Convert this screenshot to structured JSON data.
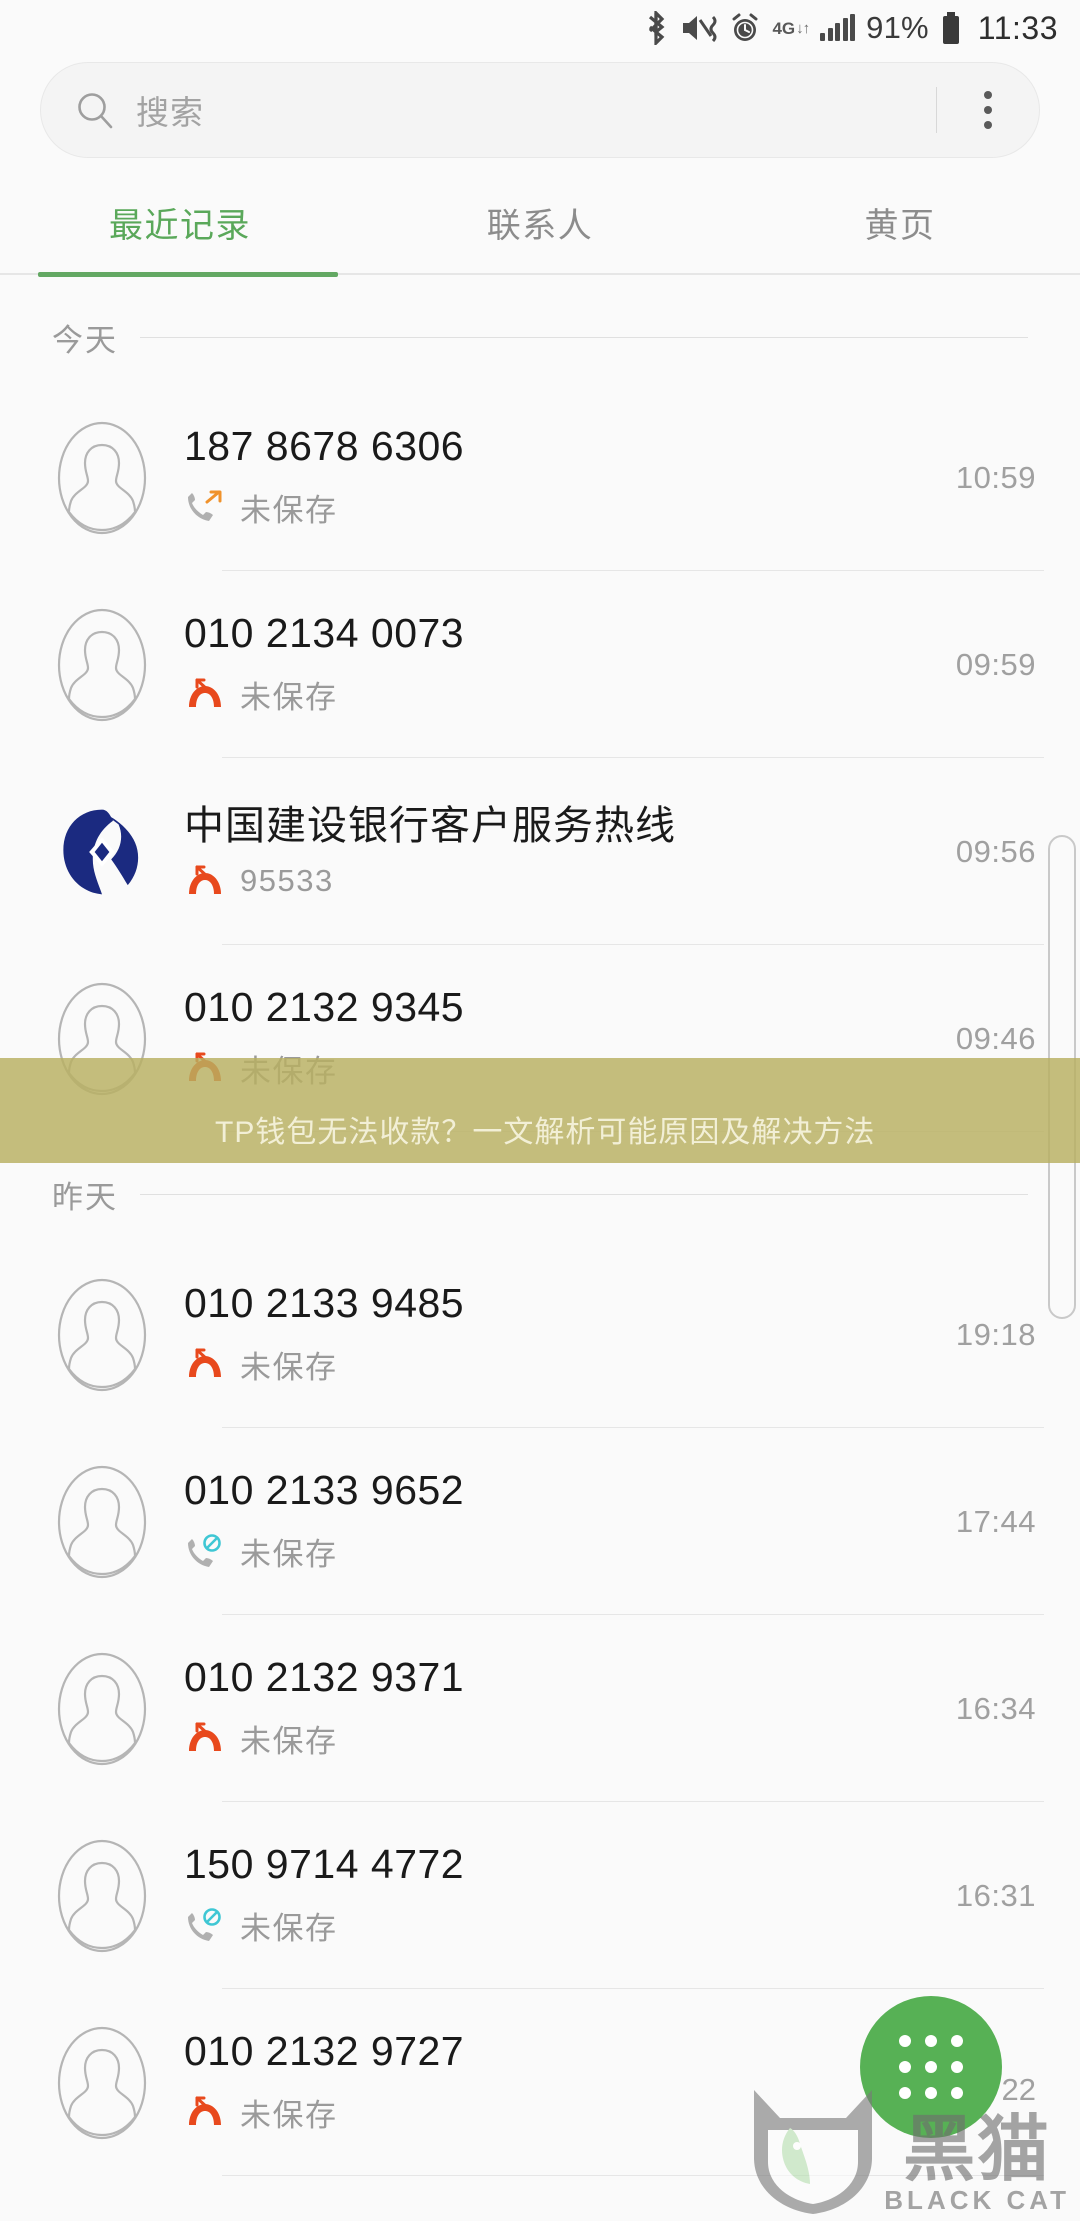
{
  "statusbar": {
    "icons": [
      "bluetooth-icon",
      "mute-vibrate-icon",
      "alarm-icon",
      "network-4g-icon",
      "signal-bars-icon",
      "battery-icon"
    ],
    "network_label": "4G",
    "battery_percent": "91%",
    "time": "11:33"
  },
  "search": {
    "placeholder": "搜索",
    "icon": "search-icon",
    "overflow_icon": "more-vertical-icon"
  },
  "tabs": [
    {
      "label": "最近记录",
      "active": true
    },
    {
      "label": "联系人",
      "active": false
    },
    {
      "label": "黄页",
      "active": false
    }
  ],
  "colors": {
    "accent_green": "#63a863",
    "missed_red": "#e8491d",
    "outgoing_orange": "#f0922b",
    "blocked_teal": "#3fc7d4",
    "banner": "#b8b060",
    "fab_green": "#57b155",
    "ccb_blue": "#1b2a80"
  },
  "groups": [
    {
      "day": "今天",
      "rows": [
        {
          "name": "187 8678 6306",
          "sub": "未保存",
          "time": "10:59",
          "type": "outgoing",
          "avatar": "person-placeholder-avatar"
        },
        {
          "name": "010 2134 0073",
          "sub": "未保存",
          "time": "09:59",
          "type": "missed",
          "avatar": "person-placeholder-avatar"
        },
        {
          "name": "中国建设银行客户服务热线",
          "sub": "95533",
          "time": "09:56",
          "type": "missed",
          "avatar": "ccb-bank-logo",
          "cn": true
        },
        {
          "name": "010 2132 9345",
          "sub": "未保存",
          "time": "09:46",
          "type": "missed",
          "avatar": "person-placeholder-avatar"
        }
      ]
    },
    {
      "day": "昨天",
      "rows": [
        {
          "name": "010 2133 9485",
          "sub": "未保存",
          "time": "19:18",
          "type": "missed",
          "avatar": "person-placeholder-avatar"
        },
        {
          "name": "010 2133 9652",
          "sub": "未保存",
          "time": "17:44",
          "type": "blocked",
          "avatar": "person-placeholder-avatar"
        },
        {
          "name": "010 2132 9371",
          "sub": "未保存",
          "time": "16:34",
          "type": "missed",
          "avatar": "person-placeholder-avatar"
        },
        {
          "name": "150 9714 4772",
          "sub": "未保存",
          "time": "16:31",
          "type": "blocked",
          "avatar": "person-placeholder-avatar"
        },
        {
          "name": "010 2132 9727",
          "sub": "未保存",
          "time": "",
          "type": "missed",
          "avatar": "person-placeholder-avatar"
        }
      ]
    }
  ],
  "banner": {
    "text": "TP钱包无法收款？一文解析可能原因及解决方法"
  },
  "fab": {
    "icon": "dialpad-icon"
  },
  "watermark": {
    "cn": "黑猫",
    "en": "BLACK CAT",
    "icon": "black-cat-logo"
  },
  "partial_time": "22"
}
